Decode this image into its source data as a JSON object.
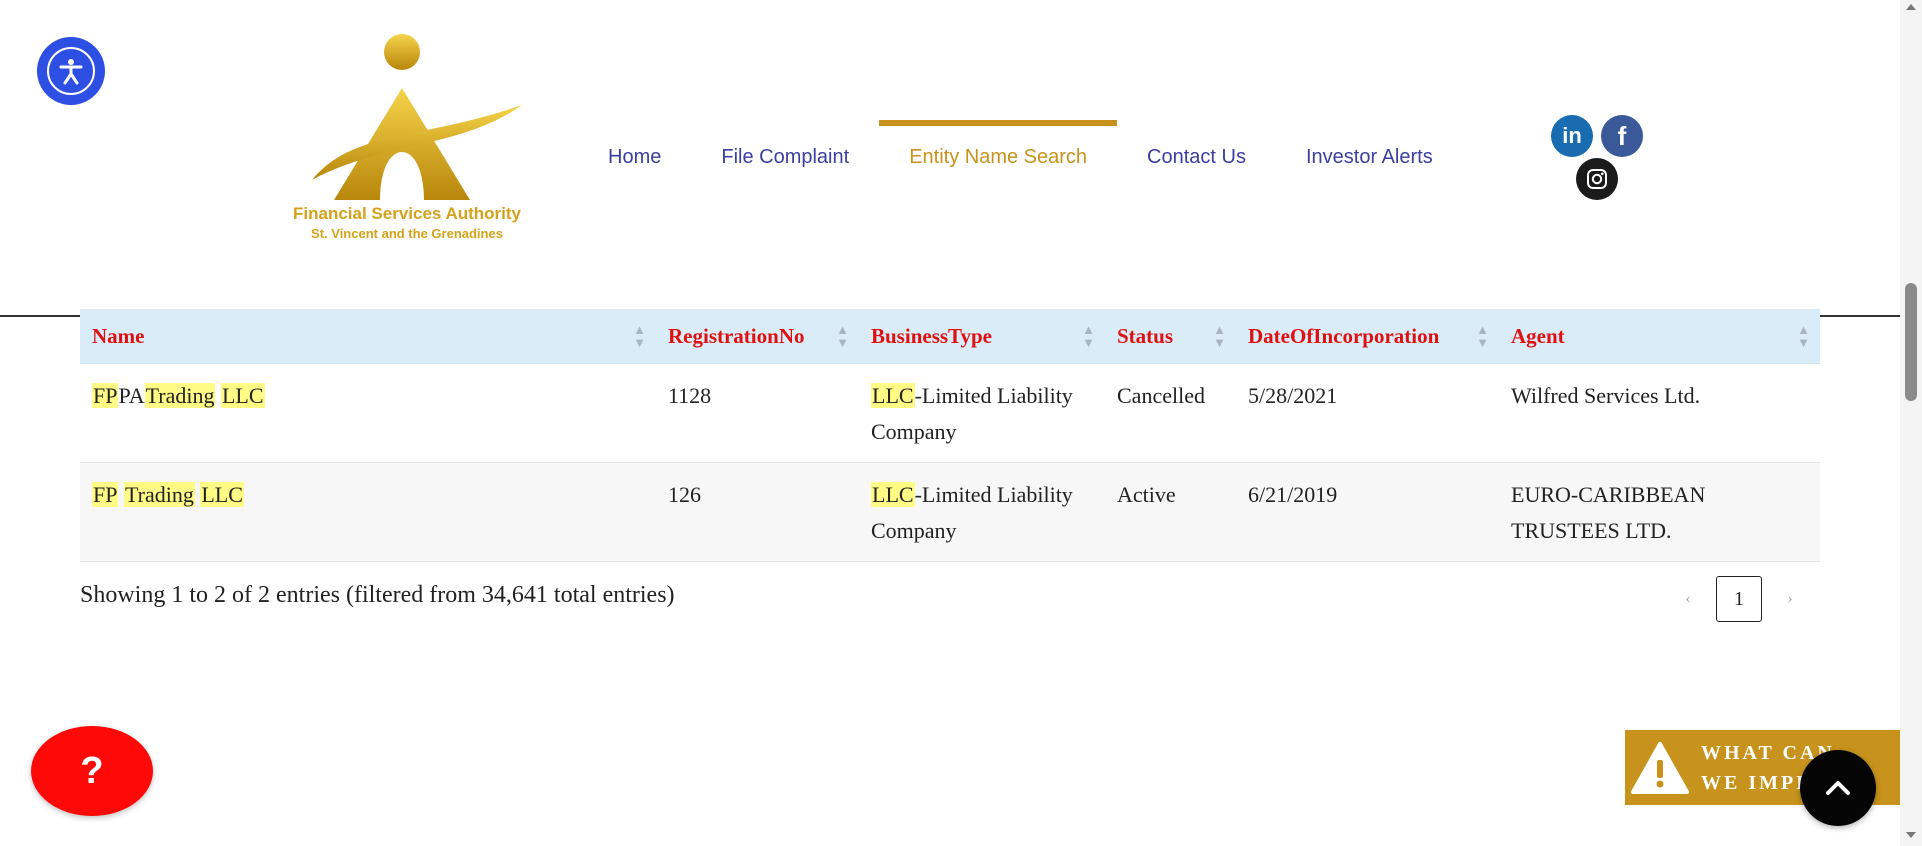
{
  "logo": {
    "line1": "Financial Services Authority",
    "line2": "St. Vincent and the Grenadines"
  },
  "nav": {
    "items": [
      {
        "label": "Home"
      },
      {
        "label": "File Complaint"
      },
      {
        "label": "Entity Name Search",
        "active": true
      },
      {
        "label": "Contact Us"
      },
      {
        "label": "Investor Alerts"
      }
    ]
  },
  "social": {
    "linkedin_glyph": "in",
    "facebook_glyph": "f"
  },
  "table": {
    "columns": [
      "Name",
      "RegistrationNo",
      "BusinessType",
      "Status",
      "DateOfIncorporation",
      "Agent"
    ],
    "rows": [
      {
        "name": [
          "FP",
          "PA",
          "Trading",
          " ",
          "LLC"
        ],
        "registration_no": "1128",
        "business_type": [
          "LLC",
          "-Limited Liability Company"
        ],
        "status": "Cancelled",
        "date": "5/28/2021",
        "agent": "Wilfred Services Ltd."
      },
      {
        "name": [
          "FP",
          " ",
          "Trading",
          " ",
          "LLC"
        ],
        "registration_no": "126",
        "business_type": [
          "LLC",
          "-Limited Liability Company"
        ],
        "status": "Active",
        "date": "6/21/2019",
        "agent": "EURO-CARIBBEAN TRUSTEES LTD."
      }
    ]
  },
  "info": "Showing 1 to 2 of 2 entries (filtered from 34,641 total entries)",
  "pager": {
    "prev": "‹",
    "page": "1",
    "next": "›"
  },
  "help_button": "?",
  "improve": {
    "line1": "WHAT CAN",
    "line2": "WE IMPROVE?"
  },
  "colors": {
    "accent_gold": "#c8931c",
    "header_red": "#e01010",
    "nav_blue": "#3a3fa0",
    "highlight": "#fffb85"
  }
}
